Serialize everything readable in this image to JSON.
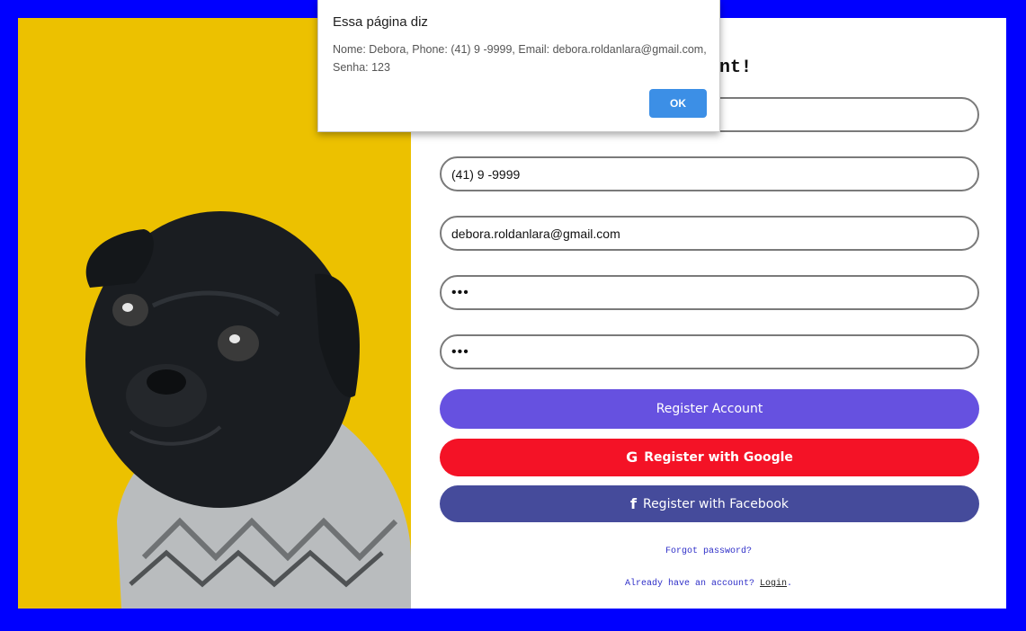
{
  "form": {
    "title": "Account!",
    "name_value": "",
    "phone_value": "(41) 9 -9999",
    "email_value": "debora.roldanlara@gmail.com",
    "password_value": "•••",
    "confirm_password_value": "•••"
  },
  "buttons": {
    "register": "Register Account",
    "google": "Register with Google",
    "google_icon": "G",
    "facebook": "Register with Facebook",
    "facebook_icon": "f"
  },
  "links": {
    "forgot": "Forgot password?",
    "already_prefix": "Already have an account? ",
    "login": "Login",
    "already_suffix": "."
  },
  "dialog": {
    "title": "Essa página diz",
    "message": "Nome: Debora, Phone: (41) 9 -9999, Email: debora.roldanlara@gmail.com, Senha: 123",
    "ok_label": "OK"
  },
  "colors": {
    "page_border": "#0000ff",
    "photo_background": "#ecc100",
    "register_button": "#6651e0",
    "google_button": "#f41226",
    "facebook_button": "#454b9b",
    "dialog_ok": "#3c8fe6"
  }
}
